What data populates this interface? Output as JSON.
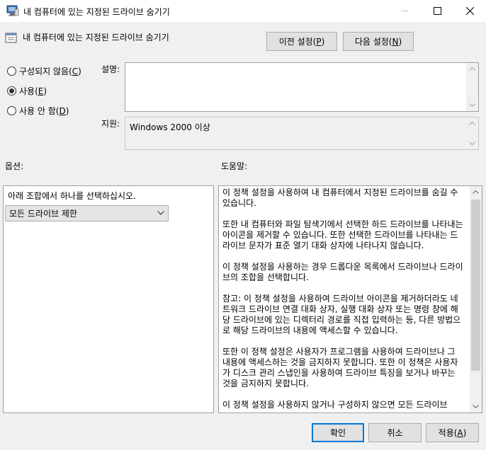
{
  "window": {
    "title": "내 컴퓨터에 있는 지정된 드라이브 숨기기"
  },
  "header": {
    "policy_title": "내 컴퓨터에 있는 지정된 드라이브 숨기기",
    "prev_button": {
      "text": "이전 설정(",
      "key": "P",
      "close": ")"
    },
    "next_button": {
      "text": "다음 설정(",
      "key": "N",
      "close": ")"
    }
  },
  "state": {
    "options": [
      {
        "text": "구성되지 않음(",
        "key": "C",
        "close": ")",
        "checked": false
      },
      {
        "text": "사용(",
        "key": "E",
        "close": ")",
        "checked": true
      },
      {
        "text": "사용 안 함(",
        "key": "D",
        "close": ")",
        "checked": false
      }
    ]
  },
  "comment": {
    "label": "설명:",
    "value": ""
  },
  "supported": {
    "label": "지원:",
    "value": "Windows 2000 이상"
  },
  "options_panel": {
    "label": "옵션:",
    "instruction": "아래 조합에서 하나를 선택하십시오.",
    "dropdown_value": "모든 드라이브 제한"
  },
  "help_panel": {
    "label": "도움말:",
    "paragraphs": [
      "이 정책 설정을 사용하여 내 컴퓨터에서 지정된 드라이브를 숨길 수 있습니다.",
      "또한 내 컴퓨터와 파일 탐색기에서 선택한 하드 드라이브를 나타내는 아이콘을 제거할 수 있습니다. 또한 선택한 드라이브를 나타내는 드라이브 문자가 표준 열기 대화 상자에 나타나지 않습니다.",
      "이 정책 설정을 사용하는 경우 드롭다운 목록에서 드라이브나 드라이브의 조합을 선택합니다.",
      "참고: 이 정책 설정을 사용하여 드라이브 아이콘을 제거하더라도 네트워크 드라이브 연결 대화 상자, 실행 대화 상자 또는 명령 창에 해당 드라이브에 있는 디렉터리 경로를 직접 입력하는 등, 다른 방법으로 해당 드라이브의 내용에 액세스할 수 있습니다.",
      "또한 이 정책 설정은 사용자가 프로그램을 사용하여 드라이브나 그 내용에 액세스하는 것을 금지하지 못합니다. 또한 이 정책은 사용자가 디스크 관리 스냅인을 사용하여 드라이브 특징을 보거나 바꾸는 것을 금지하지 못합니다.",
      "이 정책 설정을 사용하지 않거나 구성하지 않으면 모든 드라이브"
    ]
  },
  "footer": {
    "ok": "확인",
    "cancel": "취소",
    "apply": {
      "text": "적용(",
      "key": "A",
      "close": ")"
    }
  },
  "colors": {
    "accent": "#0078d7",
    "face": "#f0f0f0",
    "button": "#e1e1e1"
  }
}
